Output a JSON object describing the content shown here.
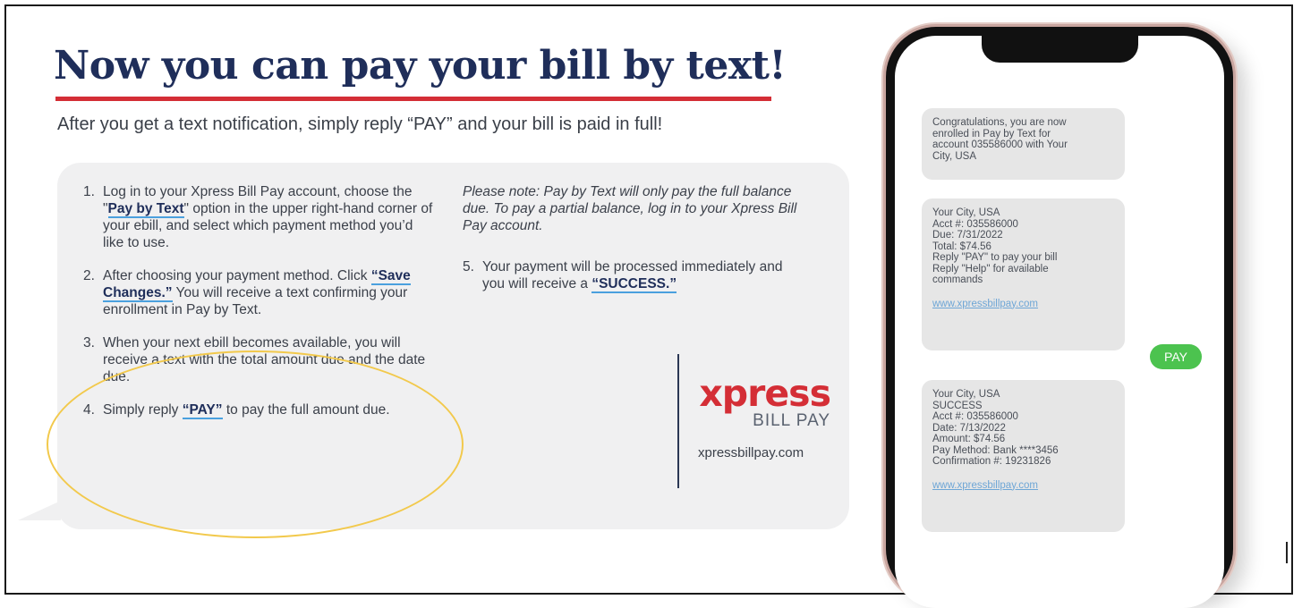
{
  "headline": "Now you can pay your bill by text!",
  "subheadline": "After you get a text notification, simply reply “PAY” and your bill is paid in full!",
  "steps": [
    {
      "num": "1.",
      "pre": "Log in to your Xpress Bill Pay account, choose the \"",
      "kw": "Pay by Text",
      "post": "\" option in the upper right-hand corner of your ebill, and select which payment method you’d like to use."
    },
    {
      "num": "2.",
      "pre": "After choosing your payment method. Click ",
      "kw": "“Save Changes.”",
      "post": " You will receive a text confirming your enrollment in Pay by Text."
    },
    {
      "num": "3.",
      "pre": "When your next ebill becomes available, you will receive a text with the total amount due and the date due.",
      "kw": "",
      "post": ""
    },
    {
      "num": "4.",
      "pre": "Simply reply ",
      "kw": "“PAY”",
      "post": " to pay the full amount due."
    }
  ],
  "note": "Please note: Pay by Text will only pay the full balance due. To pay a partial balance, log in to your Xpress Bill Pay account.",
  "step5": {
    "num": "5.",
    "pre": "Your payment will be processed immediately and you will receive a ",
    "kw": "“SUCCESS.”"
  },
  "logo": {
    "word": "xpress",
    "sub": "BILL PAY",
    "url": "xpressbillpay.com"
  },
  "phone": {
    "messages": [
      {
        "lines": [
          "Congratulations, you are now",
          "enrolled in Pay by Text for",
          "account 035586000 with Your",
          "City, USA"
        ],
        "link": ""
      },
      {
        "lines": [
          "Your City, USA",
          "Acct #: 035586000",
          "Due: 7/31/2022",
          "Total: $74.56",
          "Reply \"PAY\" to pay your bill",
          "Reply \"Help\" for available",
          "commands"
        ],
        "link": "www.xpressbillpay.com"
      },
      {
        "lines": [
          "Your City, USA",
          "SUCCESS",
          "Acct #: 035586000",
          "Date: 7/13/2022",
          "Amount: $74.56",
          "Pay Method: Bank ****3456",
          "Confirmation #: 19231826"
        ],
        "link": "www.xpressbillpay.com"
      }
    ],
    "reply": "PAY"
  },
  "colors": {
    "accent_red": "#d42e36",
    "navy": "#1f2e5a",
    "sms_green": "#4cc34f",
    "highlight_yellow": "#f2c94c"
  }
}
